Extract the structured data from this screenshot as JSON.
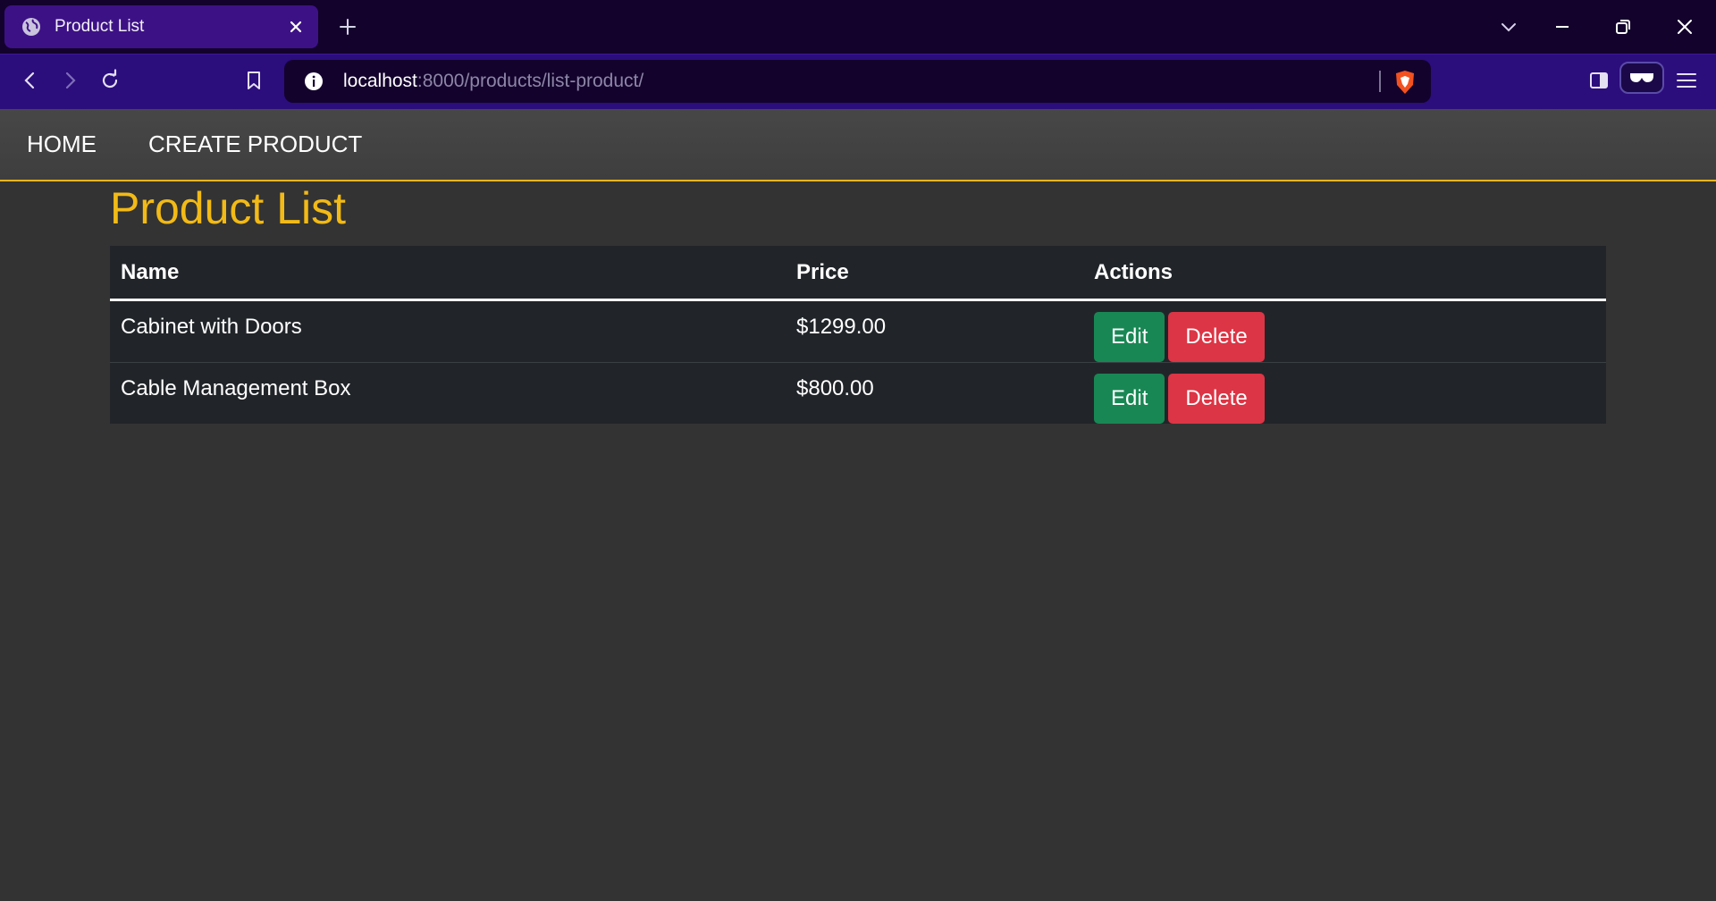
{
  "browser": {
    "tab": {
      "title": "Product List"
    },
    "url": {
      "host": "localhost",
      "rest": ":8000/products/list-product/"
    }
  },
  "nav": {
    "items": [
      {
        "label": "HOME"
      },
      {
        "label": "CREATE PRODUCT"
      }
    ]
  },
  "page": {
    "title": "Product List",
    "table": {
      "headers": {
        "name": "Name",
        "price": "Price",
        "actions": "Actions"
      },
      "rows": [
        {
          "name": "Cabinet with Doors",
          "price": "$1299.00",
          "edit": "Edit",
          "delete": "Delete"
        },
        {
          "name": "Cable Management Box",
          "price": "$800.00",
          "edit": "Edit",
          "delete": "Delete"
        }
      ]
    }
  },
  "colors": {
    "accent": "#f2ba16",
    "edit": "#198754",
    "delete": "#dc3545",
    "browser_theme": "#2c0d7c"
  }
}
